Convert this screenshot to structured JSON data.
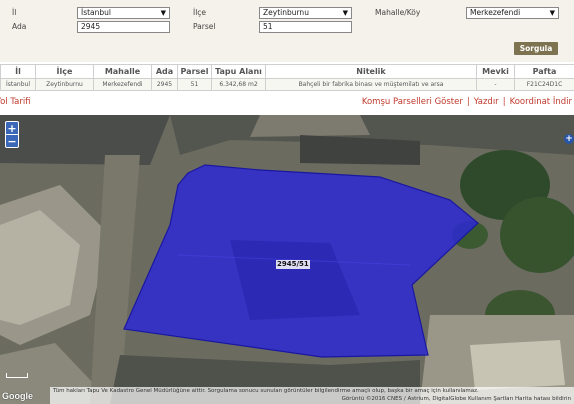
{
  "filters": {
    "il": {
      "label": "İl",
      "value": "İstanbul"
    },
    "ilce": {
      "label": "İlçe",
      "value": "Zeytinburnu"
    },
    "mahalle": {
      "label": "Mahalle/Köy",
      "value": "Merkezefendi"
    },
    "ada": {
      "label": "Ada",
      "value": "2945"
    },
    "parsel": {
      "label": "Parsel",
      "value": "51"
    },
    "arrow_icon": "triangle-down-icon",
    "submit_label": "Sorgula"
  },
  "table": {
    "headers": [
      "İl",
      "İlçe",
      "Mahalle",
      "Ada",
      "Parsel",
      "Tapu Alanı",
      "Nitelik",
      "Mevki",
      "Pafta"
    ],
    "rows": [
      [
        "İstanbul",
        "Zeytinburnu",
        "Merkezefendi",
        "2945",
        "51",
        "6.342,68 m2",
        "Bahçeli bir fabrika binası ve müştemilatı ve arsa",
        "-",
        "F21C24D1C"
      ]
    ]
  },
  "links": {
    "yol_tarifi": "Yol Tarifi",
    "komsu": "Komşu Parselleri Göster",
    "yazdir": "Yazdır",
    "koordinat": "Koordinat İndir",
    "separator": "|"
  },
  "map": {
    "zoom_in": "+",
    "zoom_out": "−",
    "layer_toggle": "+",
    "parcel_label": "2945/51",
    "google_logo": "Google",
    "disclaimer": "Tüm hakları Tapu Ve Kadastro Genel Müdürlüğüne aittir. Sorgulama sonucu sunulan görüntüler bilgilendirme amaçlı olup, başka bir amaç için kullanılamaz.",
    "attribution": "Görüntü ©2016 CNES / Astrium, DigitalGlobe  Kullanım Şartları  Harita hatası bildirin",
    "parcel_fill": "#2b27d8",
    "parcel_stroke": "#1a17a0"
  }
}
